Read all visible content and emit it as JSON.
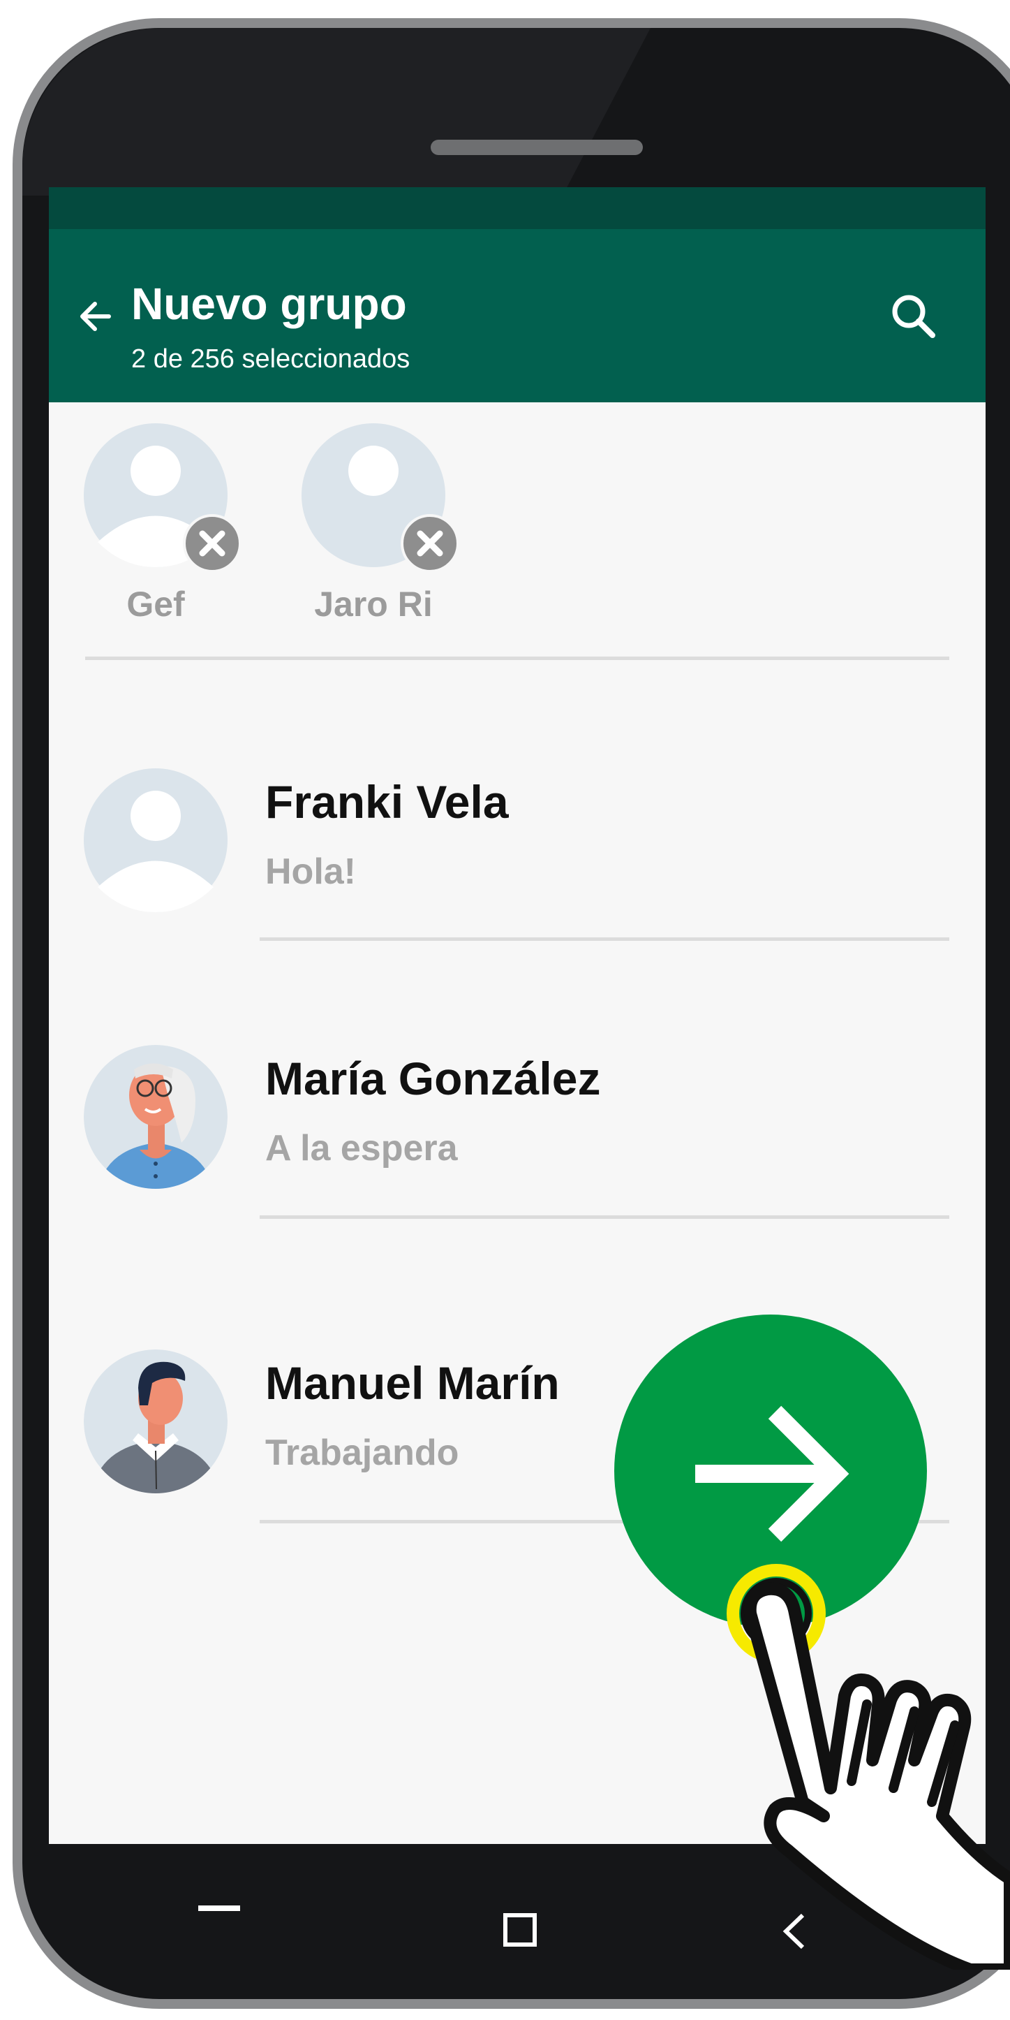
{
  "header": {
    "title": "Nuevo grupo",
    "subtitle": "2 de 256 seleccionados"
  },
  "selected": [
    {
      "name": "Gef"
    },
    {
      "name": "Jaro Ri"
    }
  ],
  "contacts": [
    {
      "name": "Franki Vela",
      "status": "Hola!",
      "avatar": "default-avatar-icon"
    },
    {
      "name": "María González",
      "status": "A la espera",
      "avatar": "woman-avatar"
    },
    {
      "name": "Manuel Marín",
      "status": "Trabajando",
      "avatar": "man-avatar"
    }
  ],
  "colors": {
    "app_bar": "#02604f",
    "status_bar": "#044a3e",
    "fab": "#019a44",
    "touch_ring": "#f6ea00"
  },
  "icons": [
    "arrow-left-icon",
    "search-icon",
    "remove-icon",
    "arrow-right-icon",
    "nav-home-icon",
    "nav-recents-icon",
    "nav-back-icon",
    "pointing-hand-icon"
  ]
}
